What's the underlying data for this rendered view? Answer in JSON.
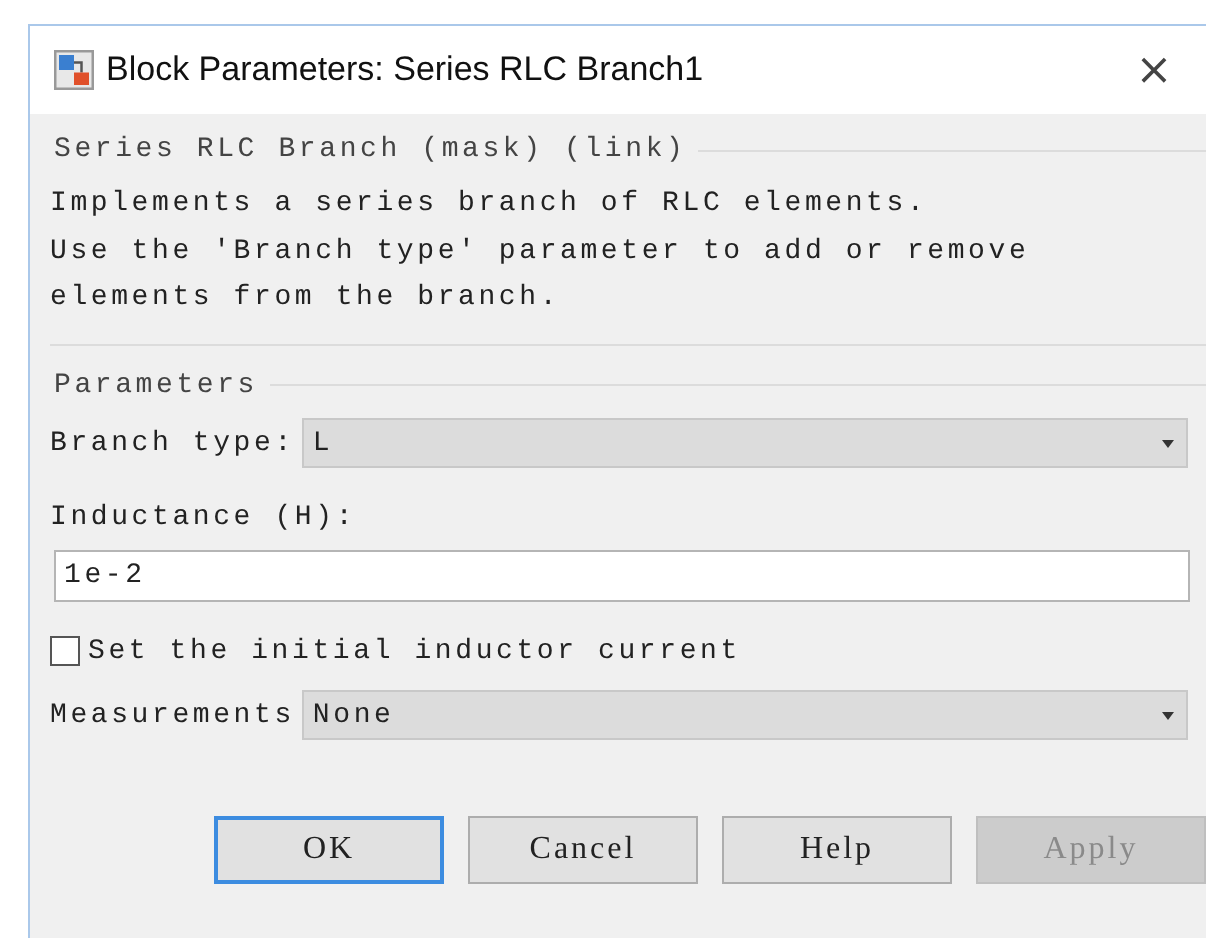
{
  "window": {
    "title": "Block Parameters: Series RLC Branch1",
    "close": "×"
  },
  "description": {
    "title": "Series RLC Branch (mask) (link)",
    "lines": [
      "Implements a series branch of RLC elements.",
      "Use the 'Branch type' parameter to add or remove",
      "elements from the branch."
    ]
  },
  "parameters": {
    "title": "Parameters",
    "items": [
      {
        "kind": "dropdown",
        "label": "Branch type:",
        "value": "L"
      },
      {
        "kind": "text",
        "label": "Inductance (H):",
        "value": "1e-2"
      },
      {
        "kind": "checkbox",
        "label": "Set the initial inductor current",
        "checked": false
      },
      {
        "kind": "dropdown",
        "label": "Measurements",
        "value": "None"
      }
    ]
  },
  "buttons": [
    {
      "label": "OK",
      "default": true,
      "disabled": false
    },
    {
      "label": "Cancel",
      "default": false,
      "disabled": false
    },
    {
      "label": "Help",
      "default": false,
      "disabled": false
    },
    {
      "label": "Apply",
      "default": false,
      "disabled": true
    }
  ]
}
